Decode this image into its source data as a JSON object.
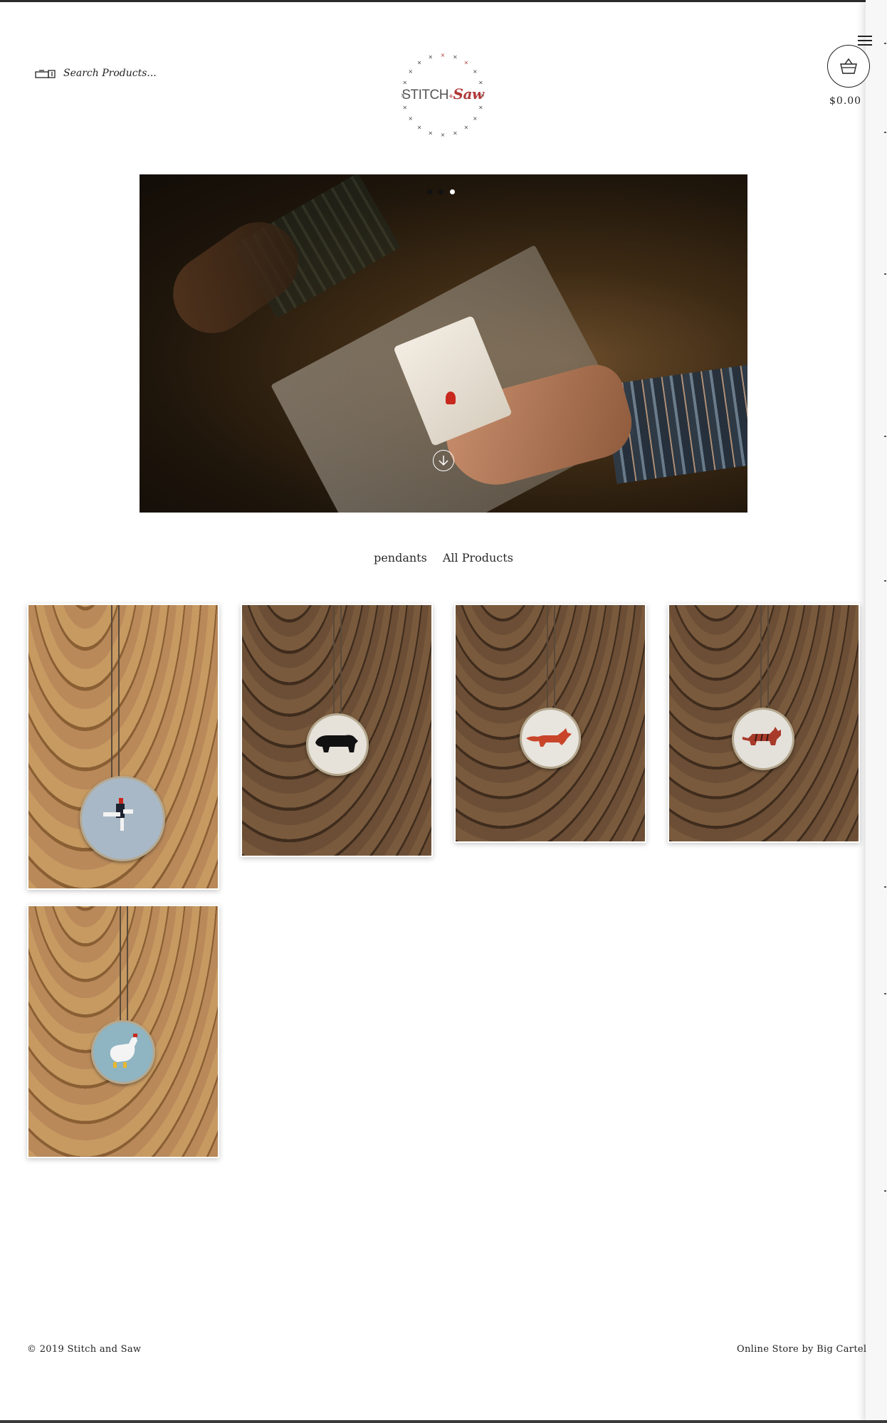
{
  "header": {
    "search_placeholder": "Search Products...",
    "logo": {
      "text_left": "STITCH",
      "text_right": "Saw",
      "joiner": "+"
    },
    "cart_total": "$0.00"
  },
  "hero": {
    "slides": 3,
    "active_slide": 3
  },
  "categories": [
    "pendants",
    "All Products"
  ],
  "products": [
    {
      "id": 1,
      "subject": "bird",
      "wood": "light",
      "pendant_color": "#a9b8c6"
    },
    {
      "id": 2,
      "subject": "bear",
      "wood": "dark",
      "pendant_color": "#e6e2da"
    },
    {
      "id": 3,
      "subject": "fox",
      "wood": "dark",
      "pendant_color": "#e8e4de"
    },
    {
      "id": 4,
      "subject": "cat",
      "wood": "dark",
      "pendant_color": "#e4e0da"
    },
    {
      "id": 5,
      "subject": "chicken",
      "wood": "light",
      "pendant_color": "#8fb4c2"
    }
  ],
  "footer": {
    "copyright": "© 2019 Stitch and Saw",
    "credit": "Online Store by Big Cartel"
  },
  "colors": {
    "accent_red": "#b03a3a",
    "text": "#2a2a2a",
    "background": "#ffffff"
  }
}
